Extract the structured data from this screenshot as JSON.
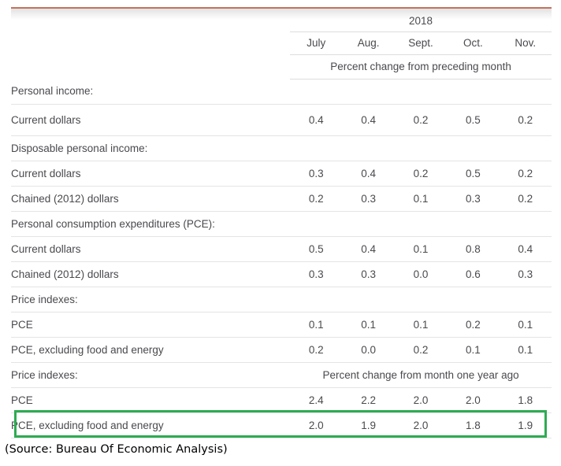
{
  "accent_colors": {
    "top_rule": "#c4725c",
    "highlight_box": "#2eab52",
    "table_text": "#4a4a4f",
    "row_divider": "#e4e4e4"
  },
  "header": {
    "year": "2018",
    "months": [
      "July",
      "Aug.",
      "Sept.",
      "Oct.",
      "Nov."
    ],
    "unit_primary": "Percent change from preceding month",
    "unit_secondary": "Percent change from month one year ago"
  },
  "rows": [
    {
      "label": "Personal income:",
      "type": "section",
      "values": [
        "",
        "",
        "",
        "",
        ""
      ]
    },
    {
      "label": "Current dollars",
      "type": "data",
      "values": [
        "0.4",
        "0.4",
        "0.2",
        "0.5",
        "0.2"
      ]
    },
    {
      "label": "Disposable personal income:",
      "type": "section",
      "values": [
        "",
        "",
        "",
        "",
        ""
      ]
    },
    {
      "label": "Current dollars",
      "type": "data",
      "values": [
        "0.3",
        "0.4",
        "0.2",
        "0.5",
        "0.2"
      ]
    },
    {
      "label": "Chained (2012) dollars",
      "type": "data",
      "values": [
        "0.2",
        "0.3",
        "0.1",
        "0.3",
        "0.2"
      ]
    },
    {
      "label": "Personal consumption expenditures (PCE):",
      "type": "section",
      "values": [
        "",
        "",
        "",
        "",
        ""
      ]
    },
    {
      "label": "Current dollars",
      "type": "data",
      "values": [
        "0.5",
        "0.4",
        "0.1",
        "0.8",
        "0.4"
      ]
    },
    {
      "label": "Chained (2012) dollars",
      "type": "data",
      "values": [
        "0.3",
        "0.3",
        "0.0",
        "0.6",
        "0.3"
      ]
    },
    {
      "label": "Price indexes:",
      "type": "section",
      "values": [
        "",
        "",
        "",
        "",
        ""
      ]
    },
    {
      "label": "PCE",
      "type": "data",
      "values": [
        "0.1",
        "0.1",
        "0.1",
        "0.2",
        "0.1"
      ]
    },
    {
      "label": "PCE, excluding food and energy",
      "type": "data",
      "values": [
        "0.2",
        "0.0",
        "0.2",
        "0.1",
        "0.1"
      ]
    },
    {
      "label": "Price indexes:",
      "type": "unit",
      "values": [
        "",
        "",
        "",
        "",
        ""
      ]
    },
    {
      "label": "PCE",
      "type": "data",
      "values": [
        "2.4",
        "2.2",
        "2.0",
        "2.0",
        "1.8"
      ]
    },
    {
      "label": "PCE, excluding food and energy",
      "type": "data",
      "values": [
        "2.0",
        "1.9",
        "2.0",
        "1.8",
        "1.9"
      ]
    }
  ],
  "source": {
    "caption": "(Source: Bureau Of Economic Analysis)"
  }
}
